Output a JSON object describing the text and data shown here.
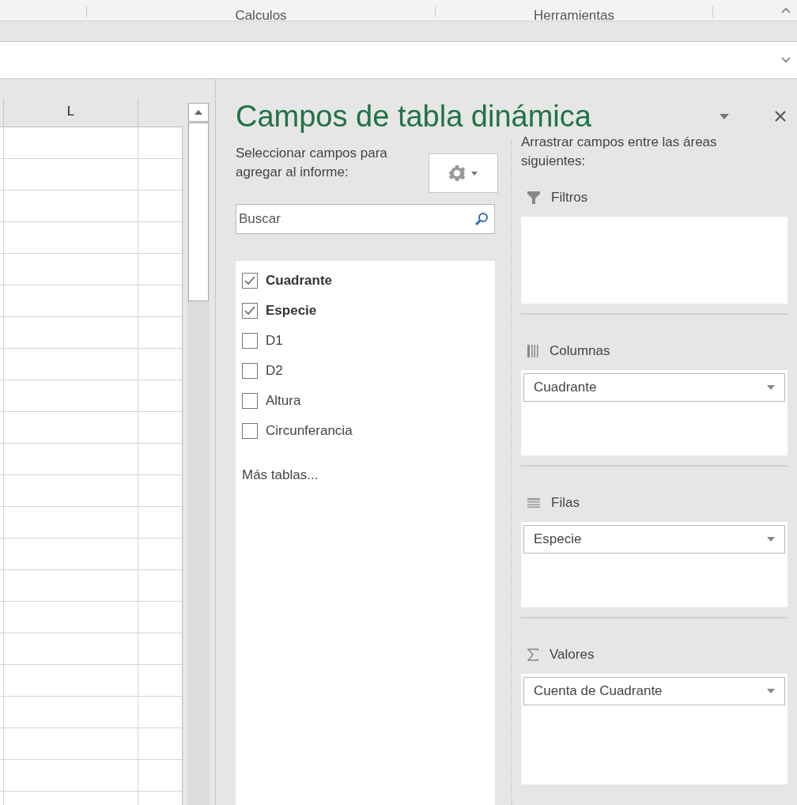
{
  "ribbon": {
    "group_labels": [
      "Calculos",
      "Herramientas"
    ]
  },
  "sheet": {
    "column_header": "L"
  },
  "pivot_pane": {
    "title": "Campos de tabla dinámica",
    "fields_label": "Seleccionar campos para agregar al informe:",
    "search": {
      "placeholder": "Buscar"
    },
    "fields": [
      {
        "label": "Cuadrante",
        "checked": true
      },
      {
        "label": "Especie",
        "checked": true
      },
      {
        "label": "D1",
        "checked": false
      },
      {
        "label": "D2",
        "checked": false
      },
      {
        "label": "Altura",
        "checked": false
      },
      {
        "label": "Circunferancia",
        "checked": false
      }
    ],
    "more_tables": "Más tablas...",
    "areas_label": "Arrastrar campos entre las áreas siguientes:",
    "areas": [
      {
        "kind": "filters",
        "label": "Filtros"
      },
      {
        "kind": "columns",
        "label": "Columnas",
        "items": [
          "Cuadrante"
        ]
      },
      {
        "kind": "rows",
        "label": "Filas",
        "items": [
          "Especie"
        ]
      },
      {
        "kind": "values",
        "label": "Valores",
        "items": [
          "Cuenta de Cuadrante"
        ]
      }
    ]
  }
}
